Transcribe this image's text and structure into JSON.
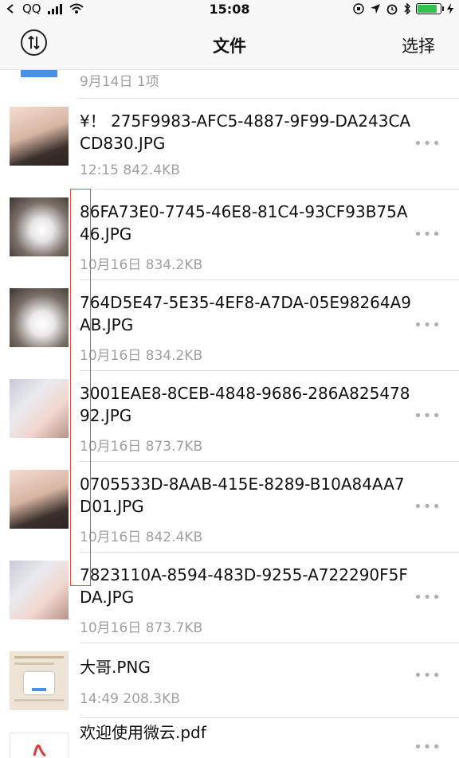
{
  "status_bar": {
    "carrier": "QQ",
    "time": "15:08"
  },
  "nav": {
    "title": "文件",
    "select_label": "选择"
  },
  "section_header": {
    "date_count": "9月14日  1项"
  },
  "files": [
    {
      "name": "¥！ 275F9983-AFC5-4887-9F99-DA243CACD830.JPG",
      "meta": "12:15  842.4KB",
      "thumb": "photo-face"
    },
    {
      "name": "86FA73E0-7745-46E8-81C4-93CF93B75A46.JPG",
      "meta": "10月16日  834.2KB",
      "thumb": "photo-light"
    },
    {
      "name": "764D5E47-5E35-4EF8-A7DA-05E98264A9AB.JPG",
      "meta": "10月16日  834.2KB",
      "thumb": "photo-light"
    },
    {
      "name": "3001EAE8-8CEB-4848-9686-286A82547892.JPG",
      "meta": "10月16日  873.7KB",
      "thumb": "photo-window"
    },
    {
      "name": "0705533D-8AAB-415E-8289-B10A84AA7D01.JPG",
      "meta": "10月16日  842.4KB",
      "thumb": "photo-face"
    },
    {
      "name": "7823110A-8594-483D-9255-A722290F5FDA.JPG",
      "meta": "10月16日  873.7KB",
      "thumb": "photo-window"
    },
    {
      "name": "大哥.PNG",
      "meta": "14:49  208.3KB",
      "thumb": "screenshot"
    },
    {
      "name": "欢迎使用微云.pdf",
      "meta": "",
      "thumb": "pdf"
    }
  ],
  "more_label": "•••",
  "colors": {
    "accent_blue": "#4a90e2",
    "meta_gray": "#a0a0a0",
    "battery_green": "#33c24d",
    "highlight_red": "#d9534f"
  }
}
